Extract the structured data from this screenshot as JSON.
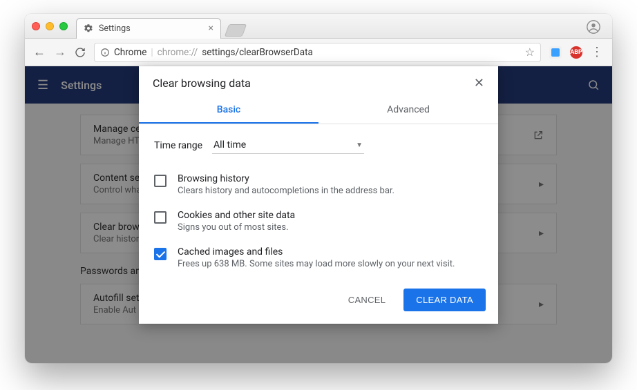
{
  "tab": {
    "title": "Settings"
  },
  "url": {
    "scheme": "Chrome",
    "host": "chrome://",
    "path": "settings/clearBrowserData"
  },
  "abp_label": "ABP",
  "app_header": {
    "title": "Settings"
  },
  "bg": {
    "card1": {
      "title": "Manage ce",
      "sub": "Manage HT"
    },
    "card2": {
      "title": "Content set",
      "sub": "Control wha"
    },
    "card3": {
      "title": "Clear brows",
      "sub": "Clear histor"
    },
    "section": "Passwords an",
    "card4": {
      "title": "Autofill sett",
      "sub": "Enable Aut"
    }
  },
  "dialog": {
    "title": "Clear browsing data",
    "tabs": {
      "basic": "Basic",
      "advanced": "Advanced"
    },
    "time_label": "Time range",
    "time_value": "All time",
    "options": [
      {
        "title": "Browsing history",
        "sub": "Clears history and autocompletions in the address bar.",
        "checked": false
      },
      {
        "title": "Cookies and other site data",
        "sub": "Signs you out of most sites.",
        "checked": false
      },
      {
        "title": "Cached images and files",
        "sub": "Frees up 638 MB. Some sites may load more slowly on your next visit.",
        "checked": true
      }
    ],
    "cancel": "CANCEL",
    "confirm": "CLEAR DATA"
  }
}
